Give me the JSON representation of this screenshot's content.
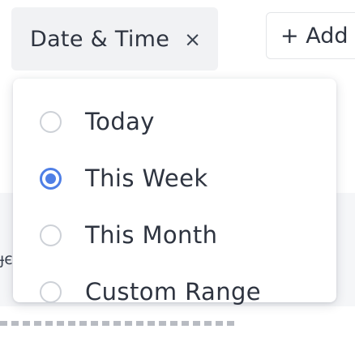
{
  "filter_chip": {
    "label": "Date & Time",
    "close_glyph": "×"
  },
  "add_button": {
    "label": "+ Add"
  },
  "dropdown": {
    "options": [
      {
        "label": "Today",
        "selected": false
      },
      {
        "label": "This Week",
        "selected": true
      },
      {
        "label": "This Month",
        "selected": false
      },
      {
        "label": "Custom Range",
        "selected": false
      }
    ]
  },
  "background": {
    "fragment_text": "ɟє"
  },
  "colors": {
    "accent": "#4f7fe6",
    "text": "#2e3440",
    "chip_bg": "#f1f2f4",
    "radio_border": "#cdd1d7"
  }
}
